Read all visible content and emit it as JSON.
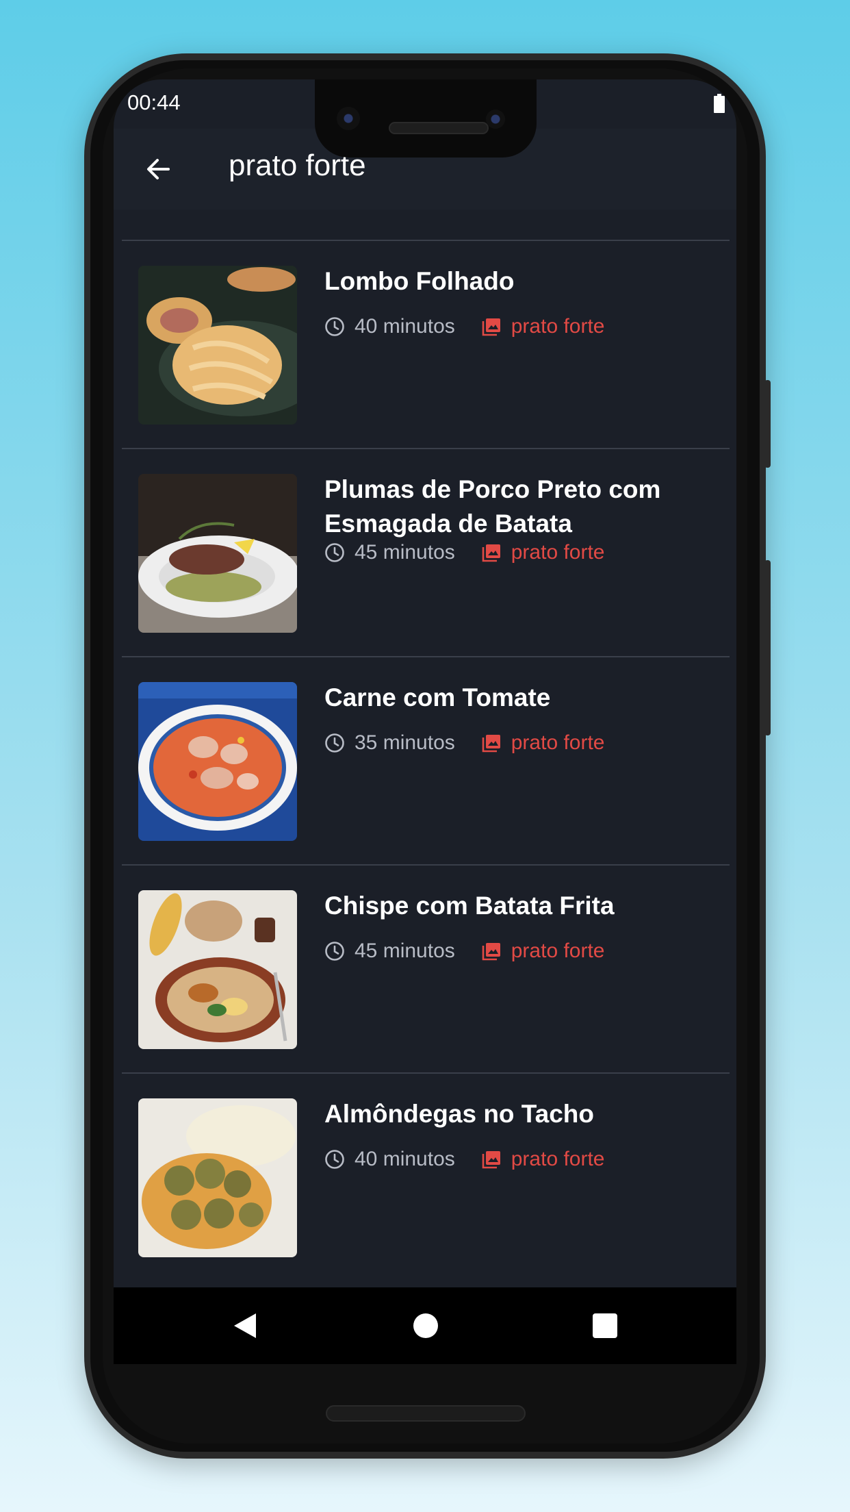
{
  "status_bar": {
    "time": "00:44"
  },
  "app_bar": {
    "title": "prato forte"
  },
  "recipes": [
    {
      "title": "Lombo Folhado",
      "time": "40 minutos",
      "category": "prato forte"
    },
    {
      "title": "Plumas de Porco Preto com Esmagada de Batata",
      "time": "45 minutos",
      "category": "prato forte"
    },
    {
      "title": "Carne com Tomate",
      "time": "35 minutos",
      "category": "prato forte"
    },
    {
      "title": "Chispe com Batata Frita",
      "time": "45 minutos",
      "category": "prato forte"
    },
    {
      "title": "Almôndegas no Tacho",
      "time": "40 minutos",
      "category": "prato forte"
    }
  ],
  "icons": {
    "back": "arrow-left-icon",
    "time": "clock-icon",
    "category": "gallery-icon",
    "nav_back": "triangle-back-icon",
    "nav_home": "circle-home-icon",
    "nav_recents": "square-recents-icon"
  },
  "colors": {
    "background": "#1b1f28",
    "app_bar": "#1d222b",
    "accent": "#e24a45",
    "secondary_text": "#b8bcc6",
    "divider": "#3a3f4a"
  }
}
